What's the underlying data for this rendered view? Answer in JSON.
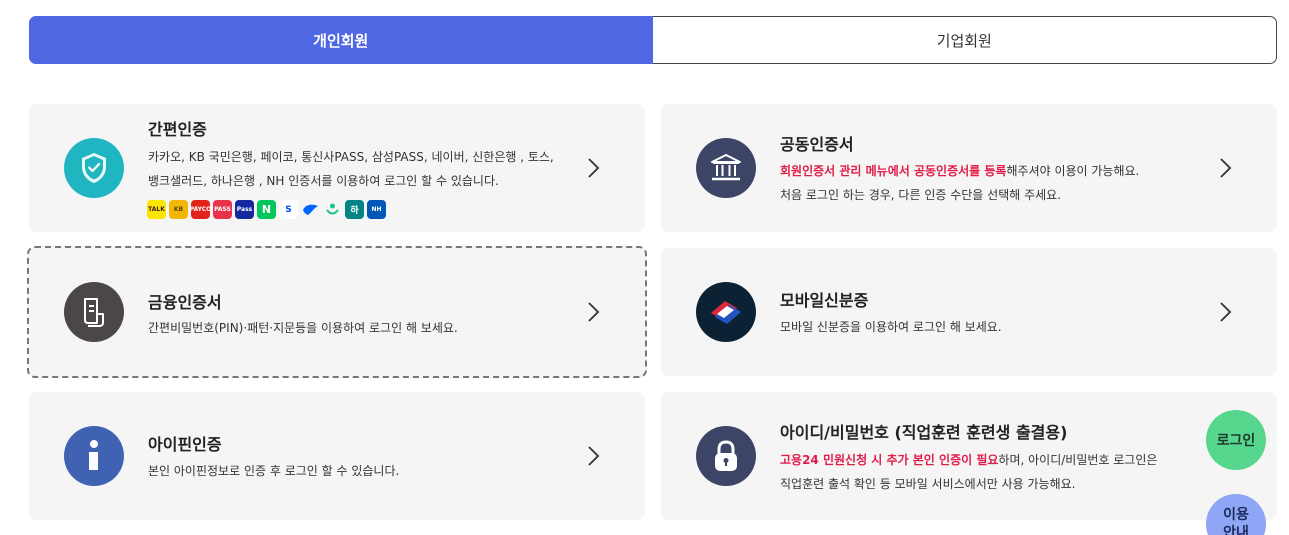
{
  "tabs": [
    {
      "label": "개인회원",
      "active": true
    },
    {
      "label": "기업회원",
      "active": false
    }
  ],
  "cards": {
    "simple": {
      "title": "간편인증",
      "desc_line1": "카카오, KB 국민은행, 페이코, 통신사PASS, 삼성PASS, 네이버, 신한은행 , 토스,",
      "desc_line2": "뱅크샐러드, 하나은행 , NH 인증서를 이용하여 로그인 할 수 있습니다.",
      "icon": "shield-check-icon",
      "icon_color": "#1fb6c1",
      "logos": [
        {
          "name": "kakao-logo",
          "text": "TALK",
          "color": "#fee500"
        },
        {
          "name": "kb-logo",
          "text": "KB",
          "color": "#f2b705"
        },
        {
          "name": "payco-logo",
          "text": "PAYCO",
          "color": "#e2231a"
        },
        {
          "name": "pass-logo",
          "text": "PASS",
          "color": "#e8334a"
        },
        {
          "name": "samsung-pass-logo",
          "text": "Pass",
          "color": "#1428a0"
        },
        {
          "name": "naver-logo",
          "text": "N",
          "color": "#03c75a"
        },
        {
          "name": "shinhan-logo",
          "text": "S",
          "color": "#ffffff"
        },
        {
          "name": "toss-logo",
          "text": "",
          "color": "#ffffff"
        },
        {
          "name": "banksalad-logo",
          "text": "",
          "color": "#ffffff"
        },
        {
          "name": "hana-logo",
          "text": "하",
          "color": "#008485"
        },
        {
          "name": "nh-logo",
          "text": "NH",
          "color": "#0057b8"
        }
      ]
    },
    "joint": {
      "title": "공동인증서",
      "desc_hl": "회원인증서 관리 메뉴에서 공동인증서를 등록",
      "desc_rest": "해주셔야 이용이 가능해요.",
      "desc_line2": "처음 로그인 하는 경우, 다른 인증 수단을 선택해 주세요.",
      "icon": "bank-icon",
      "icon_color": "#3d4566"
    },
    "financial": {
      "title": "금융인증서",
      "desc": "간편비밀번호(PIN)·패턴·지문등을 이용하여 로그인 해 보세요.",
      "icon": "document-icon",
      "icon_color": "#4a4746"
    },
    "mobile_id": {
      "title": "모바일신분증",
      "desc": "모바일 신분증을 이용하여 로그인 해 보세요.",
      "icon": "mobile-id-icon",
      "icon_color": "#0b2235"
    },
    "ipin": {
      "title": "아이핀인증",
      "desc": "본인 아이핀정보로 인증 후 로그인 할 수 있습니다.",
      "icon": "info-icon",
      "icon_color": "#3f62b2"
    },
    "idpw": {
      "title": "아이디/비밀번호 (직업훈련 훈련생 출결용)",
      "desc_hl": "고용24 민원신청 시 추가 본인 인증이 필요",
      "desc_rest": "하며, 아이디/비밀번호 로그인은",
      "desc_line2": "직업훈련 출석 확인 등 모바일 서비스에서만 사용 가능해요.",
      "icon": "lock-icon",
      "icon_color": "#3d4566"
    }
  },
  "floating": {
    "login_label": "로그인",
    "guide_label_line1": "이용",
    "guide_label_line2": "안내",
    "login_color": "#57d68d",
    "guide_color": "#8ea6f5"
  }
}
